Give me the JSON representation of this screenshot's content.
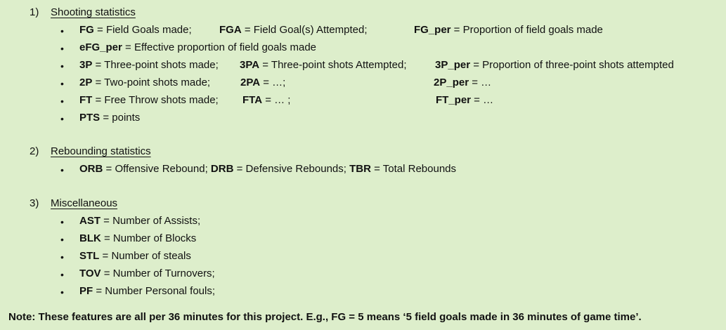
{
  "sections": [
    {
      "number": "1)",
      "title": "Shooting statistics"
    },
    {
      "number": "2)",
      "title": "Rebounding statistics"
    },
    {
      "number": "3)",
      "title": "Miscellaneous"
    }
  ],
  "bullet": "•",
  "shooting": {
    "fg": {
      "abbr": "FG",
      "def": " = Field Goals made;"
    },
    "fga": {
      "abbr": "FGA",
      "def": " =  Field Goal(s) Attempted;"
    },
    "fg_per": {
      "abbr": "FG_per",
      "def": " =  Proportion of field goals made"
    },
    "efg_per": {
      "abbr": "eFG_per",
      "def": " = Effective proportion of field goals made"
    },
    "p3": {
      "abbr": "3P",
      "def": " = Three-point shots made;"
    },
    "pa3": {
      "abbr": "3PA",
      "def": " =  Three-point shots Attempted;"
    },
    "p3_per": {
      "abbr": "3P_per",
      "def": " =  Proportion of three-point shots attempted"
    },
    "p2": {
      "abbr": "2P",
      "def": " = Two-point shots made;"
    },
    "pa2": {
      "abbr": "2PA",
      "def": " = …;"
    },
    "p2_per": {
      "abbr": "2P_per",
      "def": " = …"
    },
    "ft": {
      "abbr": "FT",
      "def": " = Free Throw shots made;"
    },
    "fta": {
      "abbr": "FTA",
      "def": " = … ;"
    },
    "ft_per": {
      "abbr": "FT_per",
      "def": " = …"
    },
    "pts": {
      "abbr": "PTS",
      "def": "  = points"
    }
  },
  "rebounding": {
    "orb": {
      "abbr": "ORB",
      "def": " = Offensive Rebound; "
    },
    "drb": {
      "abbr": "DRB",
      "def": " = Defensive Rebounds; "
    },
    "tbr": {
      "abbr": "TBR",
      "def": " = Total Rebounds"
    }
  },
  "misc": [
    {
      "abbr": "AST",
      "def": " = Number of Assists;"
    },
    {
      "abbr": "BLK",
      "def": " = Number of Blocks"
    },
    {
      "abbr": "STL",
      "def": " = Number of steals"
    },
    {
      "abbr": "TOV",
      "def": " = Number of Turnovers;"
    },
    {
      "abbr": "PF",
      "def": " = Number Personal fouls;"
    }
  ],
  "note": "Note: These features are all per 36 minutes for this project. E.g., FG = 5  means ‘5 field goals made in 36 minutes of game time’."
}
